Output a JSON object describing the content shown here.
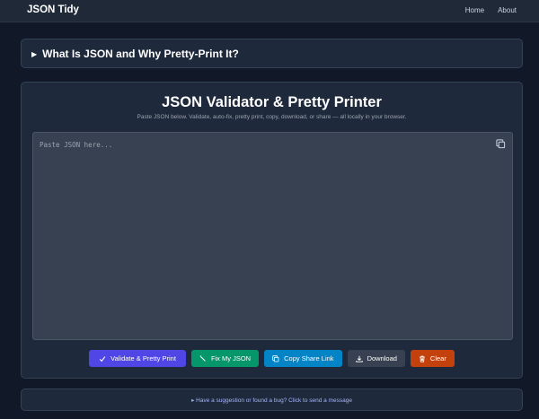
{
  "navbar": {
    "brand": "JSON Tidy",
    "links": [
      "Home",
      "About"
    ]
  },
  "faq": {
    "toggle_icon": "triangle-right-icon",
    "title": "What Is JSON and Why Pretty-Print It?"
  },
  "main": {
    "title": "JSON Validator & Pretty Printer",
    "subtitle": "Paste JSON below. Validate, auto-fix, pretty print, copy, download, or share — all locally in your browser.",
    "editor": {
      "value": "",
      "placeholder": "Paste JSON here...",
      "copy_icon": "copy-icon"
    },
    "buttons": [
      {
        "label": "Validate & Pretty Print",
        "icon": "check-icon",
        "color": "#4f46e5"
      },
      {
        "label": "Fix My JSON",
        "icon": "wand-icon",
        "color": "#059669"
      },
      {
        "label": "Copy Share Link",
        "icon": "copy-icon",
        "color": "#0284c7"
      },
      {
        "label": "Download",
        "icon": "download-icon",
        "color": "#374151"
      },
      {
        "label": "Clear",
        "icon": "trash-icon",
        "color": "#c2410c"
      }
    ]
  },
  "feedback": {
    "text": "▸ Have a suggestion or found a bug? Click to send a message"
  },
  "colors": {
    "background": "#111827",
    "card": "#1e293b",
    "editor": "#374151",
    "accent": "#4f46e5"
  }
}
